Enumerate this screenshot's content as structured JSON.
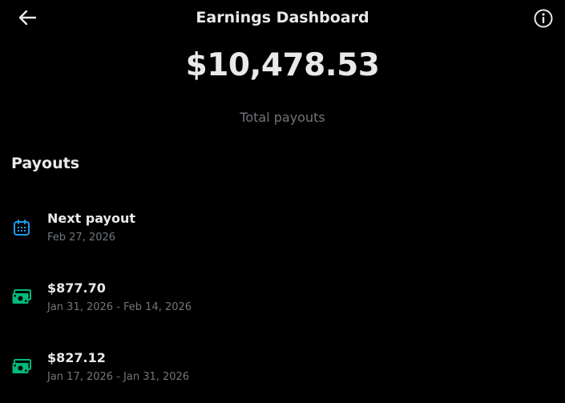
{
  "header": {
    "title": "Earnings Dashboard",
    "back_icon": "arrow-left-icon",
    "info_icon": "info-icon"
  },
  "summary": {
    "amount": "$10,478.53",
    "label": "Total payouts"
  },
  "payouts": {
    "section_title": "Payouts",
    "items": [
      {
        "icon": "calendar-icon",
        "title": "Next payout",
        "subtitle": "Feb 27, 2026"
      },
      {
        "icon": "cash-icon",
        "title": "$877.70",
        "subtitle": "Jan 31, 2026 - Feb 14, 2026"
      },
      {
        "icon": "cash-icon",
        "title": "$827.12",
        "subtitle": "Jan 17, 2026 - Jan 31, 2026"
      }
    ]
  },
  "colors": {
    "background": "#000000",
    "text_primary": "#e7e9ea",
    "text_secondary": "#71767b",
    "calendar_accent": "#1d9bf0",
    "cash_accent": "#00ba7c"
  }
}
